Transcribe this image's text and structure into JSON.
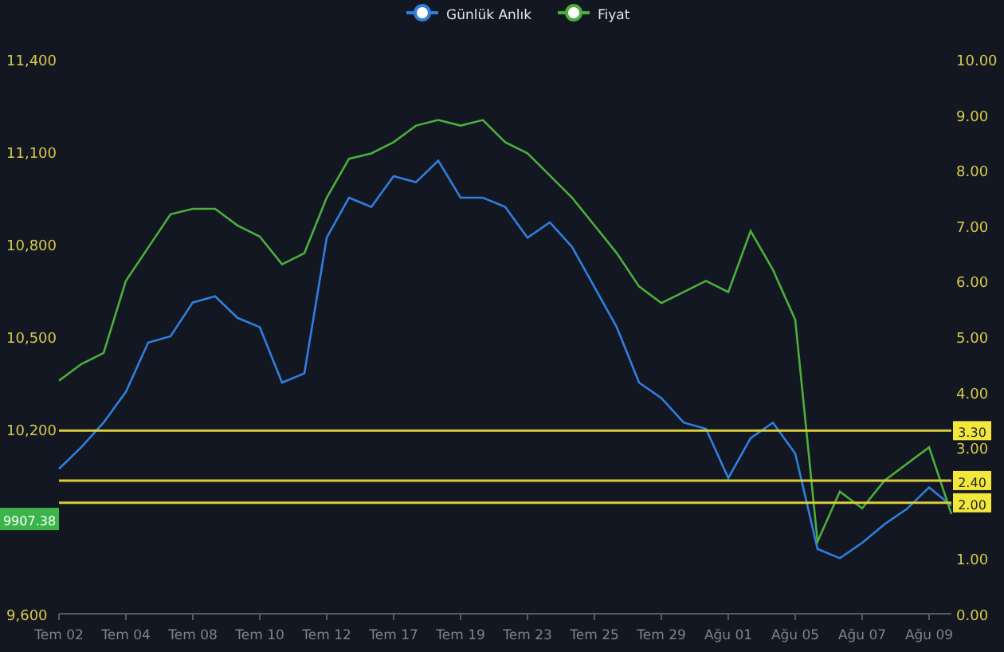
{
  "chart": {
    "chart_data": {
      "type": "line",
      "categories": [
        "Tem 02",
        null,
        null,
        "Tem 04",
        null,
        null,
        "Tem 08",
        null,
        null,
        "Tem 10",
        null,
        null,
        "Tem 12",
        null,
        null,
        "Tem 17",
        null,
        null,
        "Tem 19",
        null,
        null,
        "Tem 23",
        null,
        null,
        "Tem 25",
        null,
        null,
        "Tem 29",
        null,
        null,
        "Ağu 01",
        null,
        null,
        "Ağu 05",
        null,
        null,
        "Ağu 07",
        null,
        null,
        "Ağu 09",
        null
      ],
      "ylim": [
        9600,
        11400
      ],
      "yticks": [
        {
          "value": 9600,
          "label": "9,600"
        },
        {
          "value": 10200,
          "label": "10,200"
        },
        {
          "value": 10500,
          "label": "10,500"
        },
        {
          "value": 10800,
          "label": "10,800"
        },
        {
          "value": 11100,
          "label": "11,100"
        },
        {
          "value": 11400,
          "label": "11,400"
        }
      ],
      "y2lim": [
        0,
        10
      ],
      "y2ticks": [
        {
          "value": 0,
          "label": "0.00"
        },
        {
          "value": 1,
          "label": "1.00"
        },
        {
          "value": 3,
          "label": "3.00"
        },
        {
          "value": 4,
          "label": "4.00"
        },
        {
          "value": 5,
          "label": "5.00"
        },
        {
          "value": 6,
          "label": "6.00"
        },
        {
          "value": 7,
          "label": "7.00"
        },
        {
          "value": 8,
          "label": "8.00"
        },
        {
          "value": 9,
          "label": "9.00"
        },
        {
          "value": 10,
          "label": "10.00"
        }
      ],
      "series": [
        {
          "name": "Günlük Anlık",
          "color": "#2f7fe0",
          "values": [
            10070,
            10140,
            10220,
            10320,
            10480,
            10500,
            10610,
            10630,
            10560,
            10530,
            10350,
            10380,
            10820,
            10950,
            10920,
            11020,
            11000,
            11070,
            10950,
            10950,
            10920,
            10820,
            10870,
            10790,
            10660,
            10530,
            10350,
            10300,
            10220,
            10200,
            10040,
            10170,
            10220,
            10120,
            9810,
            9780,
            9830,
            9890,
            9940,
            10010,
            9950
          ]
        },
        {
          "name": "Fiyat",
          "color": "#4caf3c",
          "axis": "y2",
          "values": [
            4.2,
            4.5,
            4.7,
            6.0,
            6.6,
            7.2,
            7.3,
            7.3,
            7.0,
            6.8,
            6.3,
            6.5,
            7.5,
            8.2,
            8.3,
            8.5,
            8.8,
            8.9,
            8.8,
            8.9,
            8.5,
            8.3,
            7.9,
            7.5,
            7.0,
            6.5,
            5.9,
            5.6,
            5.8,
            6.0,
            5.8,
            6.9,
            6.2,
            5.3,
            1.3,
            2.2,
            1.9,
            2.4,
            2.7,
            3.0,
            1.8
          ]
        }
      ],
      "legend": "top",
      "ref_lines": [
        {
          "axis": "y2",
          "value": 3.3,
          "label": "3.30"
        },
        {
          "axis": "y2",
          "value": 2.4,
          "label": "2.40"
        },
        {
          "axis": "y2",
          "value": 2.0,
          "label": "2.00"
        }
      ],
      "annotations": [
        {
          "text": "9907.38",
          "y": 9907.38
        }
      ]
    }
  }
}
